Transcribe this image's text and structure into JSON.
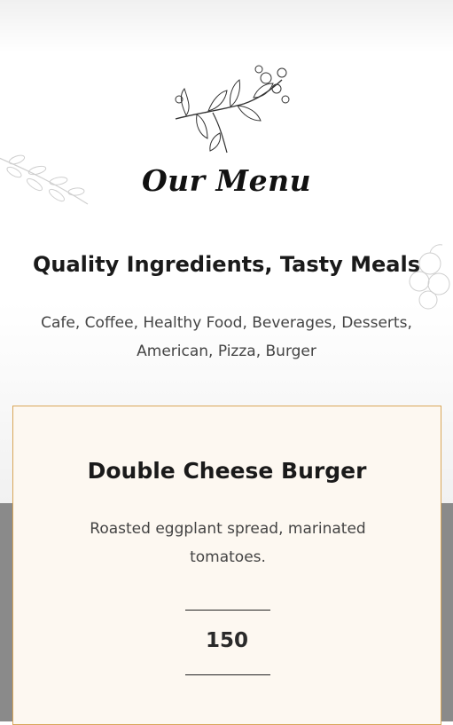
{
  "menu_section": {
    "heading": "Our Menu",
    "tagline": "Quality Ingredients, Tasty Meals",
    "categories": "Cafe, Coffee, Healthy Food, Beverages, Desserts, American, Pizza, Burger"
  },
  "menu_item": {
    "title": "Double Cheese Burger",
    "description": "Roasted eggplant spread, marinated tomatoes.",
    "price": "150"
  },
  "colors": {
    "card_background": "#fdf8f1",
    "card_border": "#d9a75a",
    "lower_band": "#8a8a8a"
  },
  "icons": [
    "herb-illustration-icon",
    "leaf-sketch-icon",
    "fruit-sketch-icon"
  ]
}
